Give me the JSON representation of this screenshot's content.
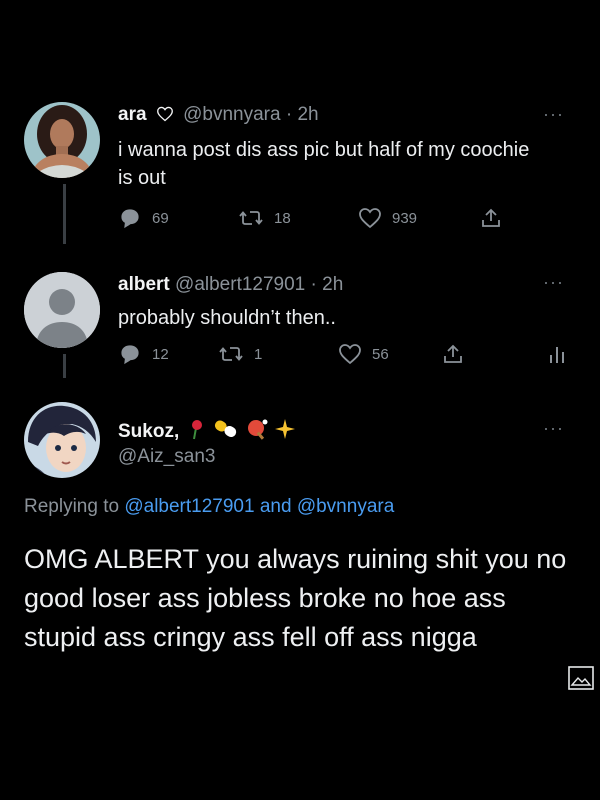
{
  "tweets": [
    {
      "name": "ara",
      "name_icon": "heart-outline-icon",
      "handle": "@bvnnyara",
      "separator": "·",
      "time": "2h",
      "text": "i wanna post dis ass pic but half of my coochie is out",
      "more": "···",
      "replies": "69",
      "retweets": "18",
      "likes": "939"
    },
    {
      "name": "albert",
      "handle": "@albert127901",
      "separator": "·",
      "time": "2h",
      "text": "probably shouldn’t then..",
      "more": "···",
      "replies": "12",
      "retweets": "1",
      "likes": "56"
    }
  ],
  "reply_tweet": {
    "name": "Sukoz,",
    "name_emojis": [
      "rose-icon",
      "pill-icon",
      "ping-pong-icon",
      "sparkle-icon"
    ],
    "handle": "@Aiz_san3",
    "more": "···",
    "replying_prefix": "Replying to",
    "replying_user1": "@albert127901",
    "replying_and": "and",
    "replying_user2": "@bvnnyara",
    "text": "OMG ALBERT you always ruining shit you no good loser ass jobless broke no hoe ass stupid ass cringy ass fell off ass nigga"
  },
  "colors": {
    "background": "#000000",
    "text": "#e7e9ea",
    "secondary": "#8b9299",
    "link": "#4a9cf0",
    "thread_line": "#3a3f44"
  }
}
